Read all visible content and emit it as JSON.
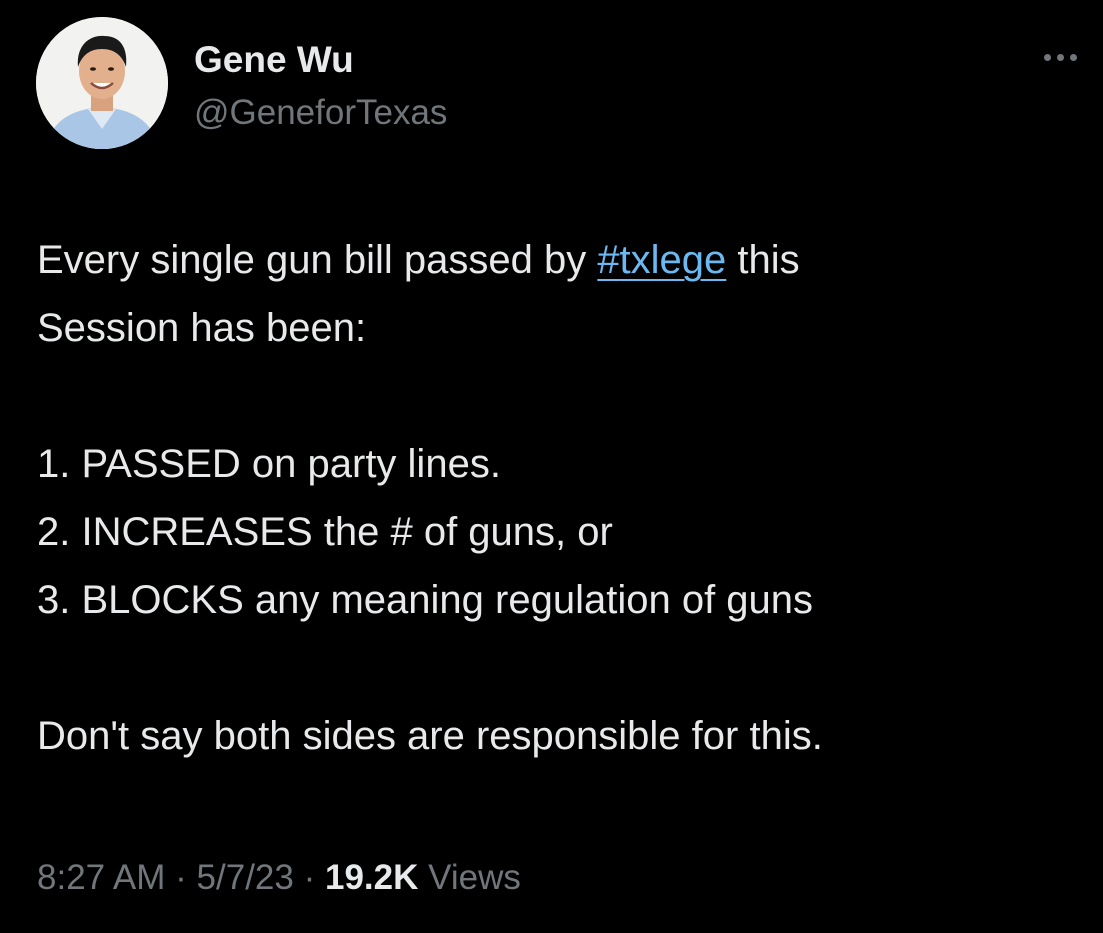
{
  "author": {
    "name": "Gene Wu",
    "handle": "@GeneforTexas",
    "avatar_icon": "profile-photo"
  },
  "more_icon": "more-horizontal-icon",
  "tweet": {
    "line1_before": "Every single gun bill passed by ",
    "hashtag": "#txlege",
    "line1_after": " this",
    "line2": "Session has been:",
    "items": [
      "1. PASSED on party lines.",
      "2. INCREASES the # of guns, or",
      "3. BLOCKS any meaning regulation of guns"
    ],
    "closing": "Don't say both sides are responsible for this."
  },
  "meta": {
    "time": "8:27 AM",
    "separator": "·",
    "date": "5/7/23",
    "views_count": "19.2K",
    "views_label": "Views"
  },
  "colors": {
    "background": "#000000",
    "text": "#e7e9ea",
    "secondary": "#71767b",
    "link": "#6cb8f0"
  }
}
